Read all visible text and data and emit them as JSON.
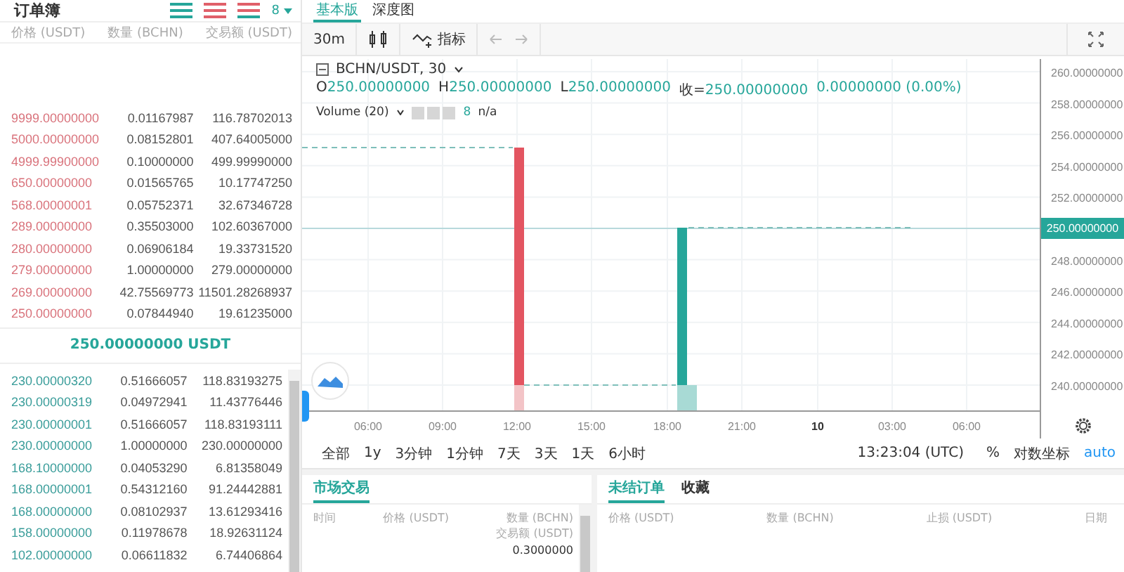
{
  "order_book": {
    "title": "订单簿",
    "precision": "8",
    "columns": [
      "价格 (USDT)",
      "数量 (BCHN)",
      "交易额 (USDT)"
    ],
    "asks": [
      {
        "price": "9999.00000000",
        "amount": "0.01167987",
        "total": "116.78702013"
      },
      {
        "price": "5000.00000000",
        "amount": "0.08152801",
        "total": "407.64005000"
      },
      {
        "price": "4999.99900000",
        "amount": "0.10000000",
        "total": "499.99990000"
      },
      {
        "price": "650.00000000",
        "amount": "0.01565765",
        "total": "10.17747250"
      },
      {
        "price": "568.00000001",
        "amount": "0.05752371",
        "total": "32.67346728"
      },
      {
        "price": "289.00000000",
        "amount": "0.35503000",
        "total": "102.60367000"
      },
      {
        "price": "280.00000000",
        "amount": "0.06906184",
        "total": "19.33731520"
      },
      {
        "price": "279.00000000",
        "amount": "1.00000000",
        "total": "279.00000000"
      },
      {
        "price": "269.00000000",
        "amount": "42.75569773",
        "total": "11501.28268937"
      },
      {
        "price": "250.00000000",
        "amount": "0.07844940",
        "total": "19.61235000"
      }
    ],
    "last_price": "250.00000000 USDT",
    "bids": [
      {
        "price": "230.00000320",
        "amount": "0.51666057",
        "total": "118.83193275"
      },
      {
        "price": "230.00000319",
        "amount": "0.04972941",
        "total": "11.43776446"
      },
      {
        "price": "230.00000001",
        "amount": "0.51666057",
        "total": "118.83193111"
      },
      {
        "price": "230.00000000",
        "amount": "1.00000000",
        "total": "230.00000000"
      },
      {
        "price": "168.10000000",
        "amount": "0.04053290",
        "total": "6.81358049"
      },
      {
        "price": "168.00000001",
        "amount": "0.54312160",
        "total": "91.24442881"
      },
      {
        "price": "168.00000000",
        "amount": "0.08102937",
        "total": "13.61293416"
      },
      {
        "price": "158.00000000",
        "amount": "0.11978678",
        "total": "18.92631124"
      },
      {
        "price": "102.00000000",
        "amount": "0.06611832",
        "total": "6.74406864"
      }
    ]
  },
  "chart_tabs": [
    {
      "label": "基本版",
      "selected": true
    },
    {
      "label": "深度图",
      "selected": false
    }
  ],
  "toolbar": {
    "interval": "30m",
    "indicators": "指标"
  },
  "legend": {
    "symbol": "BCHN/USDT, 30",
    "ohlc": [
      {
        "label": "O",
        "value": "250.00000000"
      },
      {
        "label": "H",
        "value": "250.00000000"
      },
      {
        "label": "L",
        "value": "250.00000000"
      },
      {
        "label": "收=",
        "value": "250.00000000"
      }
    ],
    "change": "0.00000000 (0.00%)",
    "volume": {
      "label": "Volume (20)",
      "value": "8",
      "reading": "n/a"
    }
  },
  "chart": {
    "y_labels": [
      "260.00000000",
      "258.00000000",
      "256.00000000",
      "254.00000000",
      "252.00000000",
      "248.00000000",
      "246.00000000",
      "244.00000000",
      "242.00000000",
      "240.00000000"
    ],
    "current_price": "250.00000000",
    "x_labels": [
      {
        "label": "06:00",
        "bold": false
      },
      {
        "label": "09:00",
        "bold": false
      },
      {
        "label": "12:00",
        "bold": false
      },
      {
        "label": "15:00",
        "bold": false
      },
      {
        "label": "18:00",
        "bold": false
      },
      {
        "label": "21:00",
        "bold": false
      },
      {
        "label": "10",
        "bold": true
      },
      {
        "label": "03:00",
        "bold": false
      },
      {
        "label": "06:00",
        "bold": false
      }
    ]
  },
  "ranges": [
    "全部",
    "1y",
    "3分钟",
    "1分钟",
    "7天",
    "3天",
    "1天",
    "6小时"
  ],
  "clock": "13:23:04 (UTC)",
  "percent": "%",
  "log_scale": "对数坐标",
  "auto": "auto",
  "market_trades": {
    "tabs": [
      {
        "label": "市场交易",
        "selected": true
      }
    ],
    "columns": [
      "时间",
      "价格 (USDT)",
      "数量 (BCHN)",
      "交易额 (USDT)"
    ],
    "partial_value": "0.3000000"
  },
  "open_orders": {
    "tabs": [
      {
        "label": "未结订单",
        "selected": true
      },
      {
        "label": "收藏",
        "selected": false
      }
    ],
    "columns": [
      "价格 (USDT)",
      "数量 (BCHN)",
      "止损 (USDT)",
      "日期"
    ]
  }
}
